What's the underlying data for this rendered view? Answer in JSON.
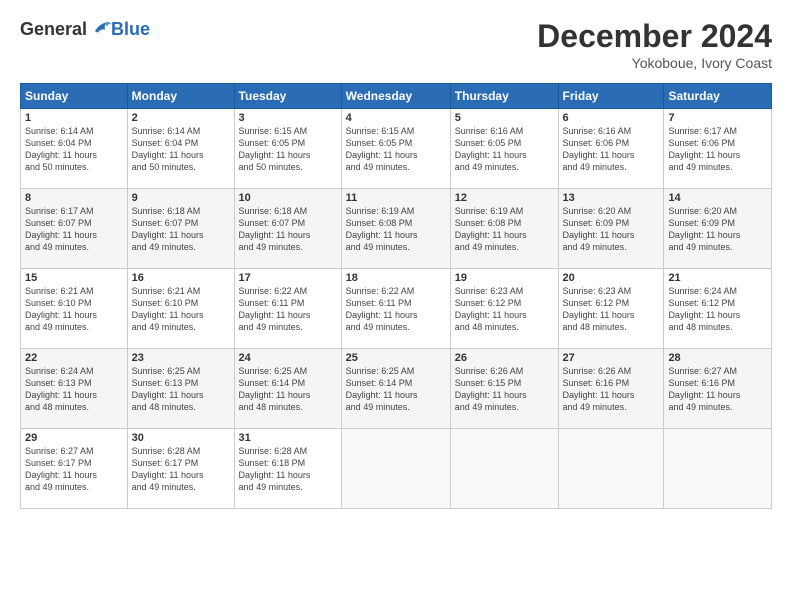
{
  "header": {
    "logo_general": "General",
    "logo_blue": "Blue",
    "month_title": "December 2024",
    "location": "Yokoboue, Ivory Coast"
  },
  "calendar": {
    "days_of_week": [
      "Sunday",
      "Monday",
      "Tuesday",
      "Wednesday",
      "Thursday",
      "Friday",
      "Saturday"
    ],
    "weeks": [
      [
        {
          "day": "1",
          "info": "Sunrise: 6:14 AM\nSunset: 6:04 PM\nDaylight: 11 hours\nand 50 minutes."
        },
        {
          "day": "2",
          "info": "Sunrise: 6:14 AM\nSunset: 6:04 PM\nDaylight: 11 hours\nand 50 minutes."
        },
        {
          "day": "3",
          "info": "Sunrise: 6:15 AM\nSunset: 6:05 PM\nDaylight: 11 hours\nand 50 minutes."
        },
        {
          "day": "4",
          "info": "Sunrise: 6:15 AM\nSunset: 6:05 PM\nDaylight: 11 hours\nand 49 minutes."
        },
        {
          "day": "5",
          "info": "Sunrise: 6:16 AM\nSunset: 6:05 PM\nDaylight: 11 hours\nand 49 minutes."
        },
        {
          "day": "6",
          "info": "Sunrise: 6:16 AM\nSunset: 6:06 PM\nDaylight: 11 hours\nand 49 minutes."
        },
        {
          "day": "7",
          "info": "Sunrise: 6:17 AM\nSunset: 6:06 PM\nDaylight: 11 hours\nand 49 minutes."
        }
      ],
      [
        {
          "day": "8",
          "info": "Sunrise: 6:17 AM\nSunset: 6:07 PM\nDaylight: 11 hours\nand 49 minutes."
        },
        {
          "day": "9",
          "info": "Sunrise: 6:18 AM\nSunset: 6:07 PM\nDaylight: 11 hours\nand 49 minutes."
        },
        {
          "day": "10",
          "info": "Sunrise: 6:18 AM\nSunset: 6:07 PM\nDaylight: 11 hours\nand 49 minutes."
        },
        {
          "day": "11",
          "info": "Sunrise: 6:19 AM\nSunset: 6:08 PM\nDaylight: 11 hours\nand 49 minutes."
        },
        {
          "day": "12",
          "info": "Sunrise: 6:19 AM\nSunset: 6:08 PM\nDaylight: 11 hours\nand 49 minutes."
        },
        {
          "day": "13",
          "info": "Sunrise: 6:20 AM\nSunset: 6:09 PM\nDaylight: 11 hours\nand 49 minutes."
        },
        {
          "day": "14",
          "info": "Sunrise: 6:20 AM\nSunset: 6:09 PM\nDaylight: 11 hours\nand 49 minutes."
        }
      ],
      [
        {
          "day": "15",
          "info": "Sunrise: 6:21 AM\nSunset: 6:10 PM\nDaylight: 11 hours\nand 49 minutes."
        },
        {
          "day": "16",
          "info": "Sunrise: 6:21 AM\nSunset: 6:10 PM\nDaylight: 11 hours\nand 49 minutes."
        },
        {
          "day": "17",
          "info": "Sunrise: 6:22 AM\nSunset: 6:11 PM\nDaylight: 11 hours\nand 49 minutes."
        },
        {
          "day": "18",
          "info": "Sunrise: 6:22 AM\nSunset: 6:11 PM\nDaylight: 11 hours\nand 49 minutes."
        },
        {
          "day": "19",
          "info": "Sunrise: 6:23 AM\nSunset: 6:12 PM\nDaylight: 11 hours\nand 48 minutes."
        },
        {
          "day": "20",
          "info": "Sunrise: 6:23 AM\nSunset: 6:12 PM\nDaylight: 11 hours\nand 48 minutes."
        },
        {
          "day": "21",
          "info": "Sunrise: 6:24 AM\nSunset: 6:12 PM\nDaylight: 11 hours\nand 48 minutes."
        }
      ],
      [
        {
          "day": "22",
          "info": "Sunrise: 6:24 AM\nSunset: 6:13 PM\nDaylight: 11 hours\nand 48 minutes."
        },
        {
          "day": "23",
          "info": "Sunrise: 6:25 AM\nSunset: 6:13 PM\nDaylight: 11 hours\nand 48 minutes."
        },
        {
          "day": "24",
          "info": "Sunrise: 6:25 AM\nSunset: 6:14 PM\nDaylight: 11 hours\nand 48 minutes."
        },
        {
          "day": "25",
          "info": "Sunrise: 6:25 AM\nSunset: 6:14 PM\nDaylight: 11 hours\nand 49 minutes."
        },
        {
          "day": "26",
          "info": "Sunrise: 6:26 AM\nSunset: 6:15 PM\nDaylight: 11 hours\nand 49 minutes."
        },
        {
          "day": "27",
          "info": "Sunrise: 6:26 AM\nSunset: 6:16 PM\nDaylight: 11 hours\nand 49 minutes."
        },
        {
          "day": "28",
          "info": "Sunrise: 6:27 AM\nSunset: 6:16 PM\nDaylight: 11 hours\nand 49 minutes."
        }
      ],
      [
        {
          "day": "29",
          "info": "Sunrise: 6:27 AM\nSunset: 6:17 PM\nDaylight: 11 hours\nand 49 minutes."
        },
        {
          "day": "30",
          "info": "Sunrise: 6:28 AM\nSunset: 6:17 PM\nDaylight: 11 hours\nand 49 minutes."
        },
        {
          "day": "31",
          "info": "Sunrise: 6:28 AM\nSunset: 6:18 PM\nDaylight: 11 hours\nand 49 minutes."
        },
        {
          "day": "",
          "info": ""
        },
        {
          "day": "",
          "info": ""
        },
        {
          "day": "",
          "info": ""
        },
        {
          "day": "",
          "info": ""
        }
      ]
    ]
  }
}
